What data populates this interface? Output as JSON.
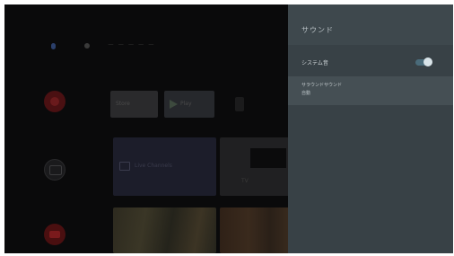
{
  "home": {
    "search_hint": "ー ー ー ー ー",
    "apps_row": {
      "store_label": "Store",
      "play_label": "Play"
    },
    "live_row": {
      "live_label": "Live Channels",
      "tv_label": "TV"
    }
  },
  "settings_panel": {
    "title": "サウンド",
    "system_sounds": {
      "label": "システム音",
      "enabled": true
    },
    "surround": {
      "label": "サラウンドサウンド",
      "value": "自動"
    }
  }
}
